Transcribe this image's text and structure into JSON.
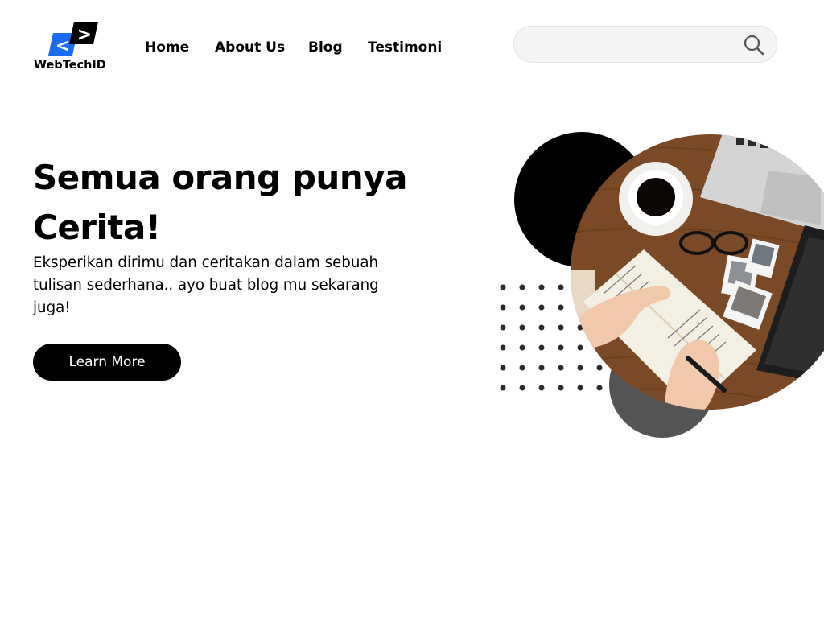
{
  "brand": {
    "name": "WebTechID",
    "left_glyph": "<",
    "right_glyph": ">",
    "accent_color": "#1a6cf0",
    "dark_color": "#000000"
  },
  "nav": {
    "items": [
      {
        "label": "Home"
      },
      {
        "label": "About Us"
      },
      {
        "label": "Blog"
      },
      {
        "label": "Testimoni"
      }
    ]
  },
  "search": {
    "value": "",
    "placeholder": "",
    "icon": "search-icon"
  },
  "hero": {
    "title_line1": "Semua orang punya",
    "title_line2": "Cerita!",
    "description": "Eksperikan dirimu dan ceritakan dalam sebuah tulisan sederhana..  ayo buat blog mu sekarang juga!",
    "cta_label": "Learn More"
  },
  "illustration": {
    "photo": "desk-writing-photo",
    "colors": {
      "black_circle": "#000000",
      "gray_circle": "#545454",
      "dots": "#2b2b2b"
    }
  }
}
